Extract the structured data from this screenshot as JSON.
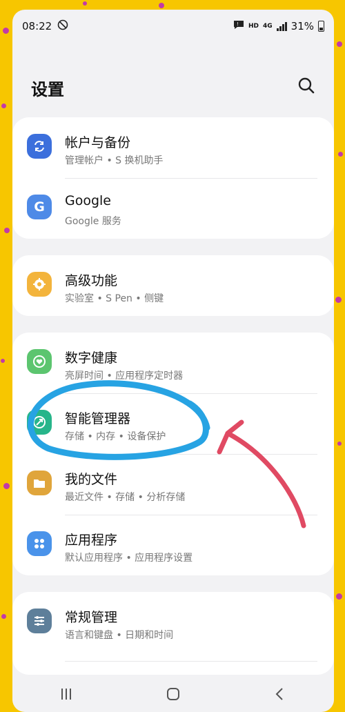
{
  "status_bar": {
    "time": "08:22",
    "network_type": "HD",
    "network_gen": "4G",
    "battery_percent": "31%",
    "icons": [
      "sync-off-icon",
      "message-icon",
      "signal-icon",
      "battery-icon"
    ]
  },
  "header": {
    "title": "设置",
    "search_icon": "search-icon"
  },
  "sections": [
    {
      "items": [
        {
          "title": "帐户与备份",
          "subtitle": "管理帐户 • S 换机助手",
          "icon": "sync-icon",
          "color": "#3c6fdc"
        },
        {
          "title": "Google",
          "subtitle": "Google 服务",
          "icon": "google-g-icon",
          "color": "#4e8ae7"
        }
      ]
    },
    {
      "items": [
        {
          "title": "高级功能",
          "subtitle": "实验室 • S Pen • 侧键",
          "icon": "advanced-features-icon",
          "color": "#f3b43c"
        }
      ]
    },
    {
      "items": [
        {
          "title": "数字健康",
          "subtitle": "亮屏时间 • 应用程序定时器",
          "icon": "digital-wellbeing-icon",
          "color": "#5cc56f"
        },
        {
          "title": "智能管理器",
          "subtitle": "存储 • 内存 • 设备保护",
          "icon": "device-care-icon",
          "color": "#27b58a"
        },
        {
          "title": "我的文件",
          "subtitle": "最近文件 • 存储 • 分析存储",
          "icon": "folder-icon",
          "color": "#e0a53b"
        },
        {
          "title": "应用程序",
          "subtitle": "默认应用程序 • 应用程序设置",
          "icon": "apps-icon",
          "color": "#4a93ea"
        }
      ]
    },
    {
      "items": [
        {
          "title": "常规管理",
          "subtitle": "语言和键盘 • 日期和时间",
          "icon": "general-management-icon",
          "color": "#5e7f9a"
        }
      ]
    }
  ],
  "annotations": {
    "circle_color": "#27a3e3",
    "arrow_color": "#e04a63",
    "highlighted_item": "智能管理器"
  },
  "navbar": {
    "recents_icon": "recents-icon",
    "home_icon": "home-icon",
    "back_icon": "back-icon"
  }
}
